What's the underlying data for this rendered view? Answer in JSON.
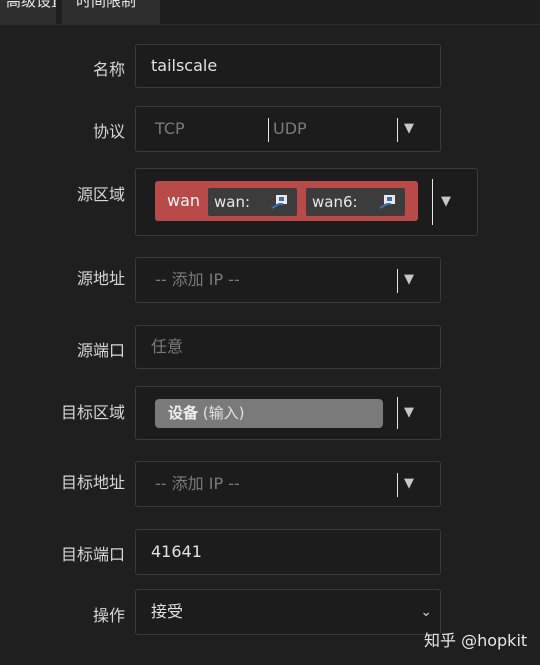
{
  "tabs": [
    "高级设置",
    "时间限制"
  ],
  "form": {
    "name": {
      "label": "名称",
      "value": "tailscale"
    },
    "protocol": {
      "label": "协议",
      "options": [
        "TCP",
        "UDP"
      ]
    },
    "src_zone": {
      "label": "源区域",
      "zone": "wan",
      "networks": [
        "wan:",
        "wan6:"
      ]
    },
    "src_addr": {
      "label": "源地址",
      "placeholder": "-- 添加 IP --"
    },
    "src_port": {
      "label": "源端口",
      "placeholder": "任意"
    },
    "dest_zone": {
      "label": "目标区域",
      "device": "设备",
      "device_sub": "(输入)"
    },
    "dest_addr": {
      "label": "目标地址",
      "placeholder": "-- 添加 IP --"
    },
    "dest_port": {
      "label": "目标端口",
      "value": "41641"
    },
    "action": {
      "label": "操作",
      "value": "接受"
    }
  },
  "watermark": "知乎 @hopkit",
  "colors": {
    "zone_red": "#b84a4a",
    "chip_grey": "#7a7a7a",
    "bg": "#1e1e1e"
  }
}
